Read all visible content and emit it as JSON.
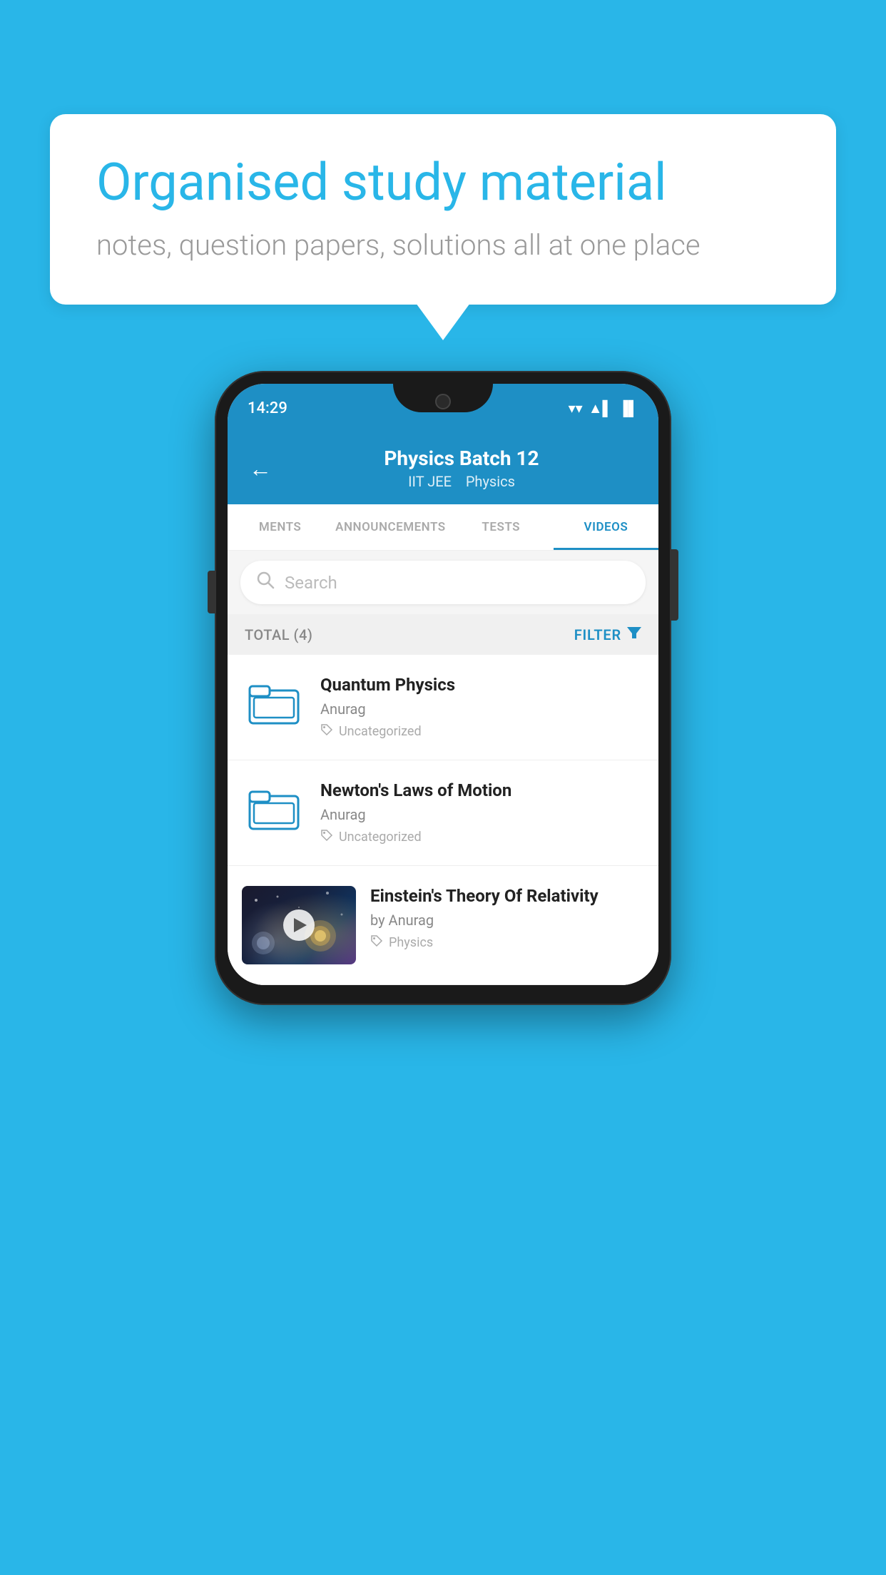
{
  "background_color": "#29b6e8",
  "speech_bubble": {
    "title": "Organised study material",
    "subtitle": "notes, question papers, solutions all at one place"
  },
  "status_bar": {
    "time": "14:29",
    "wifi": "▼",
    "signal": "▲",
    "battery": "▌"
  },
  "app_header": {
    "back_label": "←",
    "title": "Physics Batch 12",
    "subtitle_part1": "IIT JEE",
    "subtitle_part2": "Physics"
  },
  "tabs": [
    {
      "label": "MENTS",
      "active": false
    },
    {
      "label": "ANNOUNCEMENTS",
      "active": false
    },
    {
      "label": "TESTS",
      "active": false
    },
    {
      "label": "VIDEOS",
      "active": true
    }
  ],
  "search": {
    "placeholder": "Search"
  },
  "filter_bar": {
    "total_label": "TOTAL (4)",
    "filter_label": "FILTER"
  },
  "video_items": [
    {
      "title": "Quantum Physics",
      "author": "Anurag",
      "tag": "Uncategorized",
      "type": "folder"
    },
    {
      "title": "Newton's Laws of Motion",
      "author": "Anurag",
      "tag": "Uncategorized",
      "type": "folder"
    },
    {
      "title": "Einstein's Theory Of Relativity",
      "author": "by Anurag",
      "tag": "Physics",
      "type": "video"
    }
  ],
  "icons": {
    "search": "🔍",
    "filter_funnel": "▼",
    "back": "←",
    "tag": "🏷"
  }
}
